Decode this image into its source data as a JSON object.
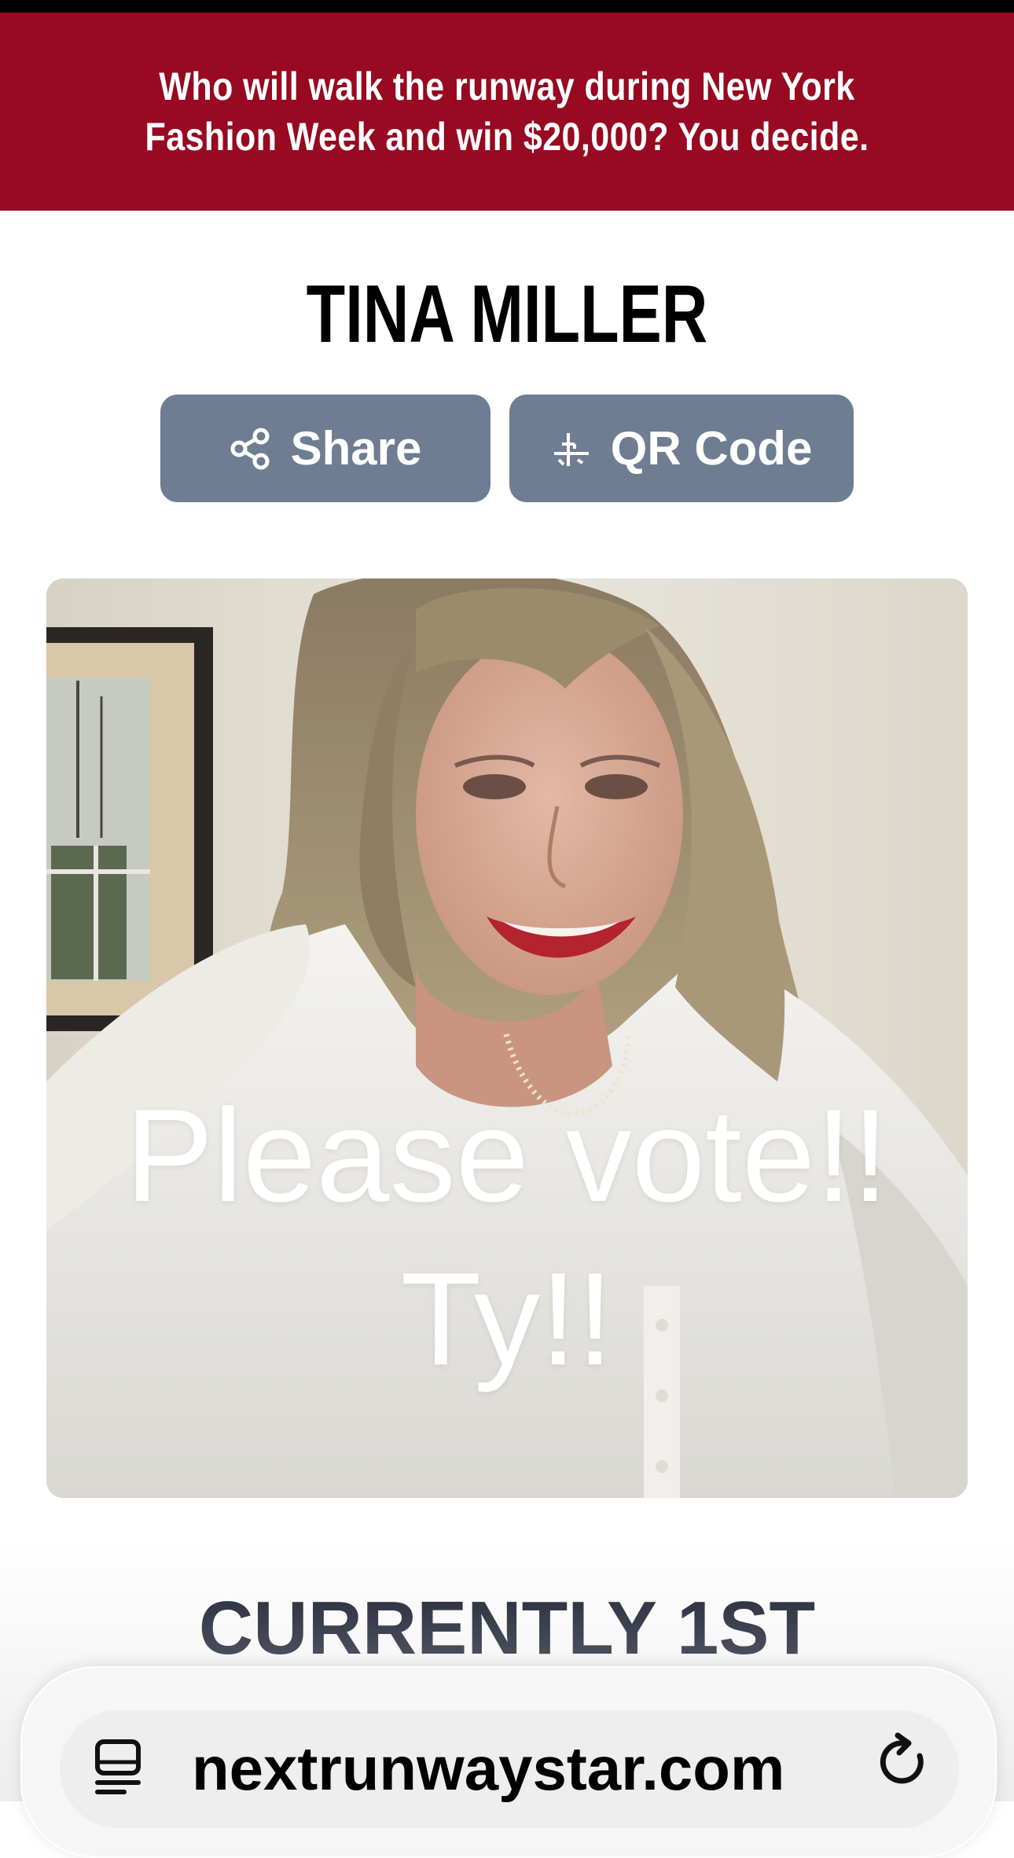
{
  "colors": {
    "banner_bg": "#970a21",
    "button_bg": "#6e7d91",
    "rank_text": "#141a2c",
    "ghost_text": "#c0283c"
  },
  "banner": {
    "text": "Who will walk the runway during New York Fashion Week and win $20,000?  You decide."
  },
  "contestant": {
    "name": "TINA MILLER"
  },
  "actions": {
    "share": {
      "label": "Share",
      "icon": "share-icon"
    },
    "qr": {
      "label": "QR Code",
      "icon": "qr-code-icon"
    }
  },
  "video": {
    "caption_line1": "Please vote!!",
    "caption_line2": "Ty!!"
  },
  "status": {
    "rank_text": "CURRENTLY 1ST"
  },
  "browser": {
    "url": "nextrunwaystar.com",
    "site_icon": "site-settings-icon",
    "reload_icon": "reload-icon"
  }
}
